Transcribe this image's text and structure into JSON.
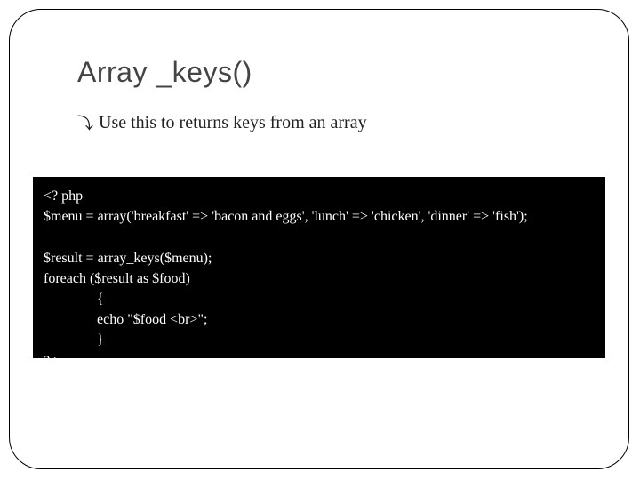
{
  "slide": {
    "title": "Array _keys()",
    "subtitle": "Use this to returns keys from an array",
    "code": {
      "line1": "<? php",
      "line2": "$menu = array('breakfast' => 'bacon and eggs', 'lunch' => 'chicken', 'dinner' => 'fish');",
      "line3": "",
      "line4": "$result = array_keys($menu);",
      "line5": "foreach ($result as $food)",
      "line6": "               {",
      "line7": "               echo \"$food <br>\";",
      "line8": "               }",
      "line9": "? >"
    }
  }
}
